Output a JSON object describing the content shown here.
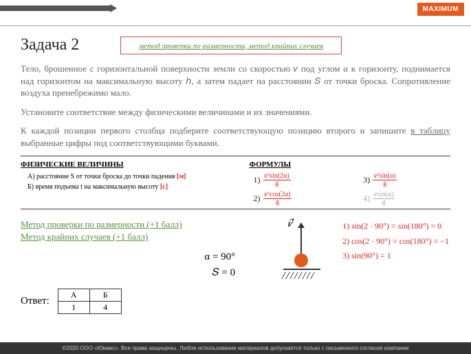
{
  "logo": "MAXIMUM",
  "title": "Задача 2",
  "method_hint": "метод проверки по размерности, метод крайних случаев",
  "para1": "Тело, брошенное с горизонтальной поверхности земли со скоростью 𝑣 под углом α к горизонту, поднимается над горизонтом на максимальную высоту ℎ, а затем падает на расстоянии 𝑆 от точки броска. Сопротивление воздуха пренебрежимо мало.",
  "para2": "Установите соответствие между физическими величинами  и их значениями.",
  "para3_a": "К каждой позиции первого столбца подберите соответствующую позицию второго и запишите ",
  "para3_b": "в таблицу",
  "para3_c": " выбранные цифры под соответствующими буквами.",
  "col_left_head": "ФИЗИЧЕСКИЕ ВЕЛИЧИНЫ",
  "col_right_head": "ФОРМУЛЫ",
  "phys_a_pre": "А) расстояние S от точки броска до точки падения ",
  "phys_a_unit": "[м]",
  "phys_b_pre": "Б) время подъема t  на максимальную высоту ",
  "phys_b_unit": "[с]",
  "f1n": "1)",
  "f1top": "𝑣²sin(2α)",
  "f1bot": "g",
  "f2n": "2)",
  "f2top": "𝑣²cos(2α)",
  "f2bot": "g",
  "f3n": "3)",
  "f3top": "𝑣²sin(α)",
  "f3bot": "g",
  "f4n": "4)",
  "f4top": "𝑣sin(α)",
  "f4bot": "g",
  "green1": "Метод проверки по размерности (+1 балл)",
  "green2": "Метод крайних случаев (+1 балл)",
  "alpha": "α = 90°",
  "s_zero": "𝑆 = 0",
  "v_label": "𝑣⃗",
  "check1": "1) sin(2 · 90°) = sin(180°) = 0",
  "check2": "2) cos(2 · 90°) = cos(180°) = −1",
  "check3": "3) sin(90°) = 1",
  "answer_label": "Ответ:",
  "ans": {
    "h1": "А",
    "h2": "Б",
    "v1": "1",
    "v2": "4"
  },
  "footer": "©2020 ООО «Юмакс». Все права защищены. Любое использование материалов допускается только с письменного согласия компании"
}
